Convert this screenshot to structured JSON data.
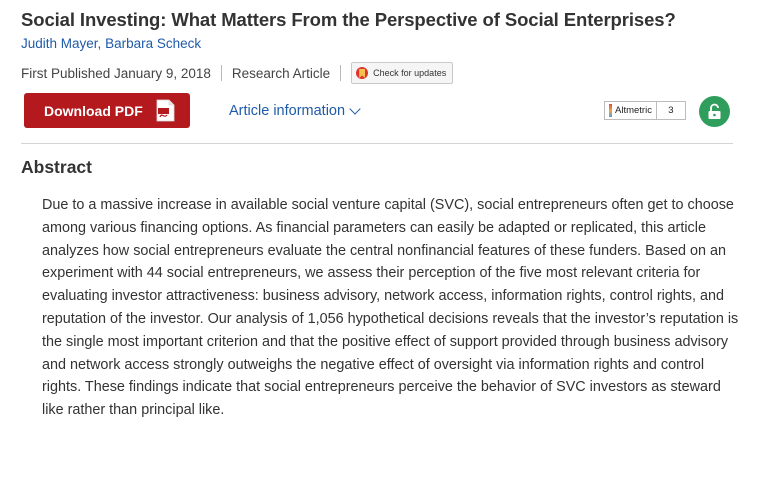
{
  "article": {
    "title": "Social Investing: What Matters From the Perspective of Social Enterprises?",
    "authors": [
      "Judith Mayer",
      "Barbara Scheck"
    ],
    "author_separator": ", ",
    "published": "First Published January 9, 2018",
    "type": "Research Article"
  },
  "toolbar": {
    "check_updates": "Check for updates",
    "download_pdf": "Download PDF",
    "article_information": "Article information",
    "altmetric_label": "Altmetric",
    "altmetric_score": "3"
  },
  "abstract": {
    "heading": "Abstract",
    "text": "Due to a massive increase in available social venture capital (SVC), social entrepreneurs often get to choose among various financing options. As financial parameters can easily be adapted or replicated, this article analyzes how social entrepreneurs evaluate the central nonfinancial features of these funders. Based on an experiment with 44 social entrepreneurs, we assess their perception of the five most relevant criteria for evaluating investor attractiveness: business advisory, network access, information rights, control rights, and reputation of the investor. Our analysis of 1,056 hypothetical decisions reveals that the investor’s reputation is the single most important criterion and that the positive effect of support provided through business advisory and network access strongly outweighs the negative effect of oversight via information rights and control rights. These findings indicate that social entrepreneurs perceive the behavior of SVC investors as steward like rather than principal like."
  },
  "icons": {
    "pdf": "pdf-file-icon",
    "chevron": "chevron-down-icon",
    "lock": "open-lock-icon",
    "crossmark": "crossmark-icon"
  },
  "colors": {
    "link": "#1f5ba8",
    "download_button": "#b3191d",
    "open_access": "#2f9e5c",
    "text": "#333333"
  }
}
